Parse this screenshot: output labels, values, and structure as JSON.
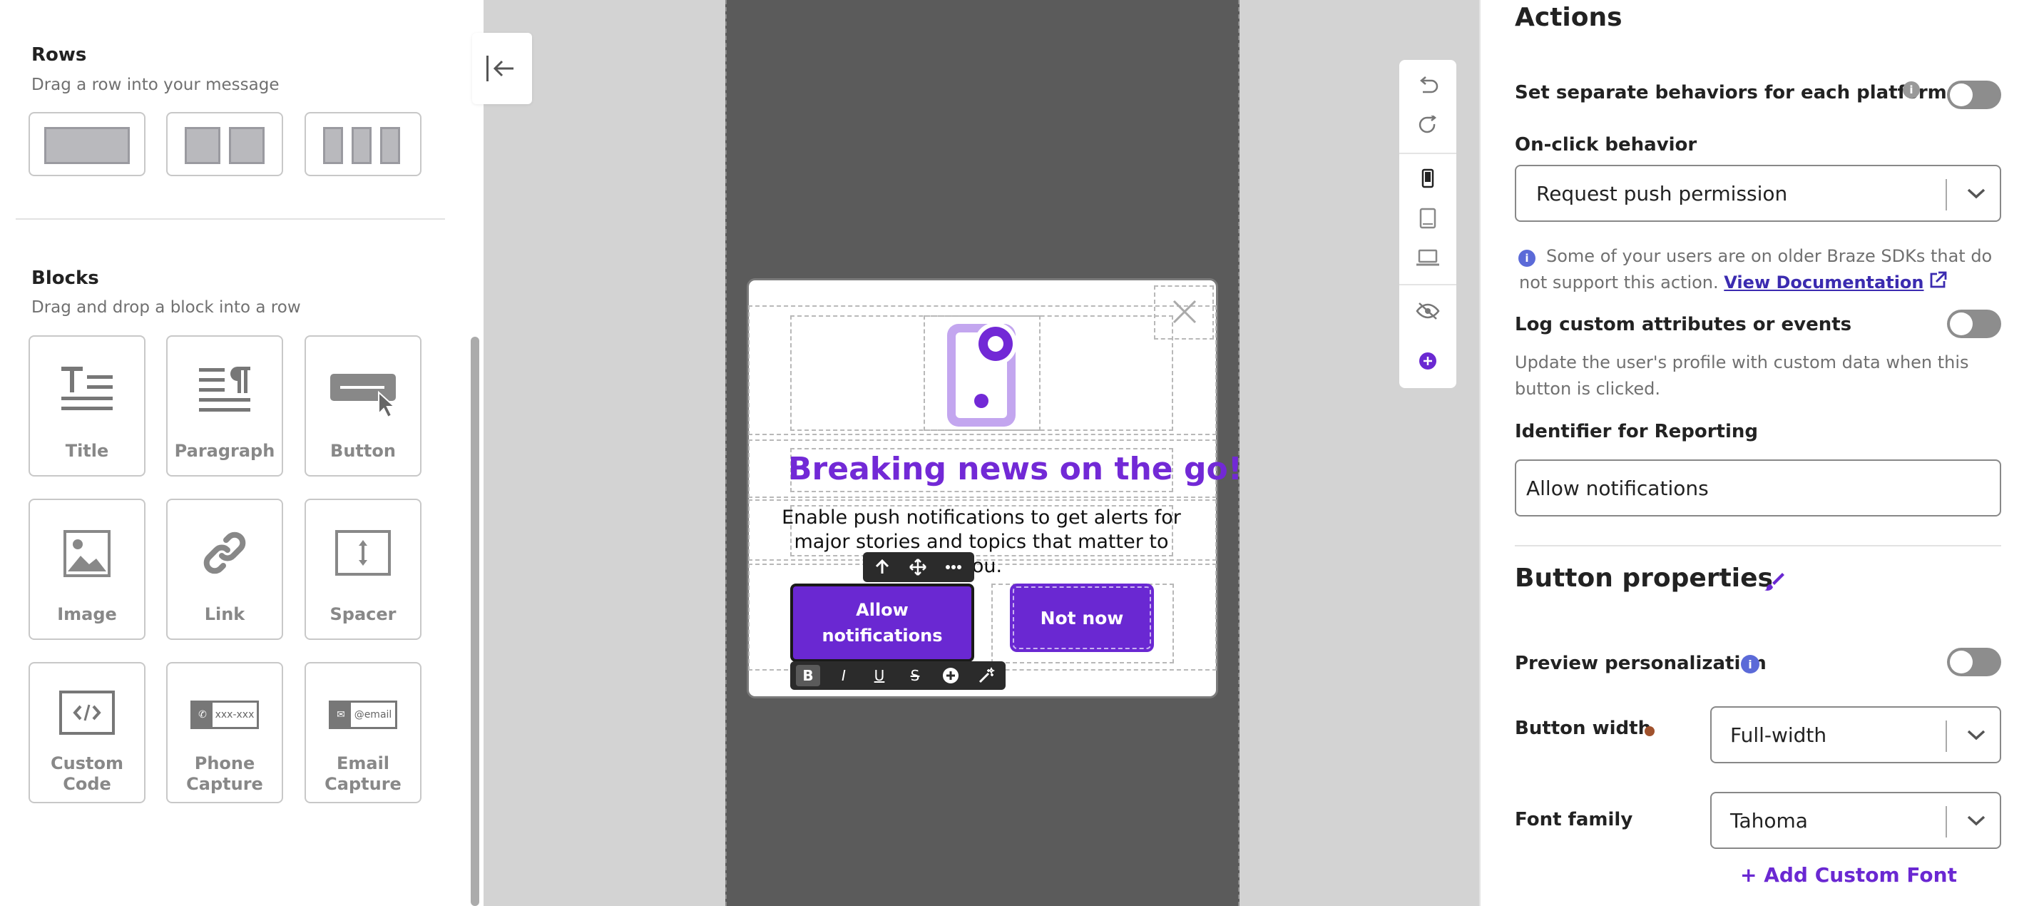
{
  "left_panel": {
    "rows": {
      "title": "Rows",
      "subtitle": "Drag a row into your message"
    },
    "blocks": {
      "title": "Blocks",
      "subtitle": "Drag and drop a block into a row",
      "items": [
        {
          "label": "Title",
          "icon": "title-icon"
        },
        {
          "label": "Paragraph",
          "icon": "paragraph-icon"
        },
        {
          "label": "Button",
          "icon": "button-icon"
        },
        {
          "label": "Image",
          "icon": "image-icon"
        },
        {
          "label": "Link",
          "icon": "link-icon"
        },
        {
          "label": "Spacer",
          "icon": "spacer-icon"
        },
        {
          "label": "Custom\nCode",
          "icon": "code-icon"
        },
        {
          "label": "Phone\nCapture",
          "icon": "phone-capture-icon",
          "icon_text": "xxx-xxx"
        },
        {
          "label": "Email\nCapture",
          "icon": "email-capture-icon",
          "icon_text": "@email"
        }
      ]
    }
  },
  "canvas": {
    "message": {
      "headline": "Breaking news on the go!",
      "body": "Enable push notifications to get alerts for major stories and topics that matter to you.",
      "primary_button": "Allow notifications",
      "secondary_button": "Not now"
    },
    "format_toolbar": [
      "B",
      "I",
      "U",
      "S"
    ]
  },
  "right_panel": {
    "actions_title": "Actions",
    "separate_behaviors_label": "Set separate behaviors for each platform",
    "onclick_label": "On-click behavior",
    "onclick_value": "Request push permission",
    "sdk_notice": "Some of your users are on older Braze SDKs that do not support this action.",
    "view_docs_link": "View Documentation",
    "log_custom_label": "Log custom attributes or events",
    "log_custom_desc": "Update the user's profile with custom data when this button is clicked.",
    "identifier_label": "Identifier for Reporting",
    "identifier_value": "Allow notifications",
    "button_properties_title": "Button properties",
    "preview_personalization_label": "Preview personalization",
    "button_width_label": "Button width",
    "button_width_value": "Full-width",
    "font_family_label": "Font family",
    "font_family_value": "Tahoma",
    "add_custom_font": "+ Add Custom Font"
  },
  "colors": {
    "accent_purple": "#6a28d2",
    "headline_purple": "#7229d6",
    "link_blue": "#3b2bb0",
    "modified_dot": "#a0522d",
    "info_blue": "#5b6ad8"
  }
}
